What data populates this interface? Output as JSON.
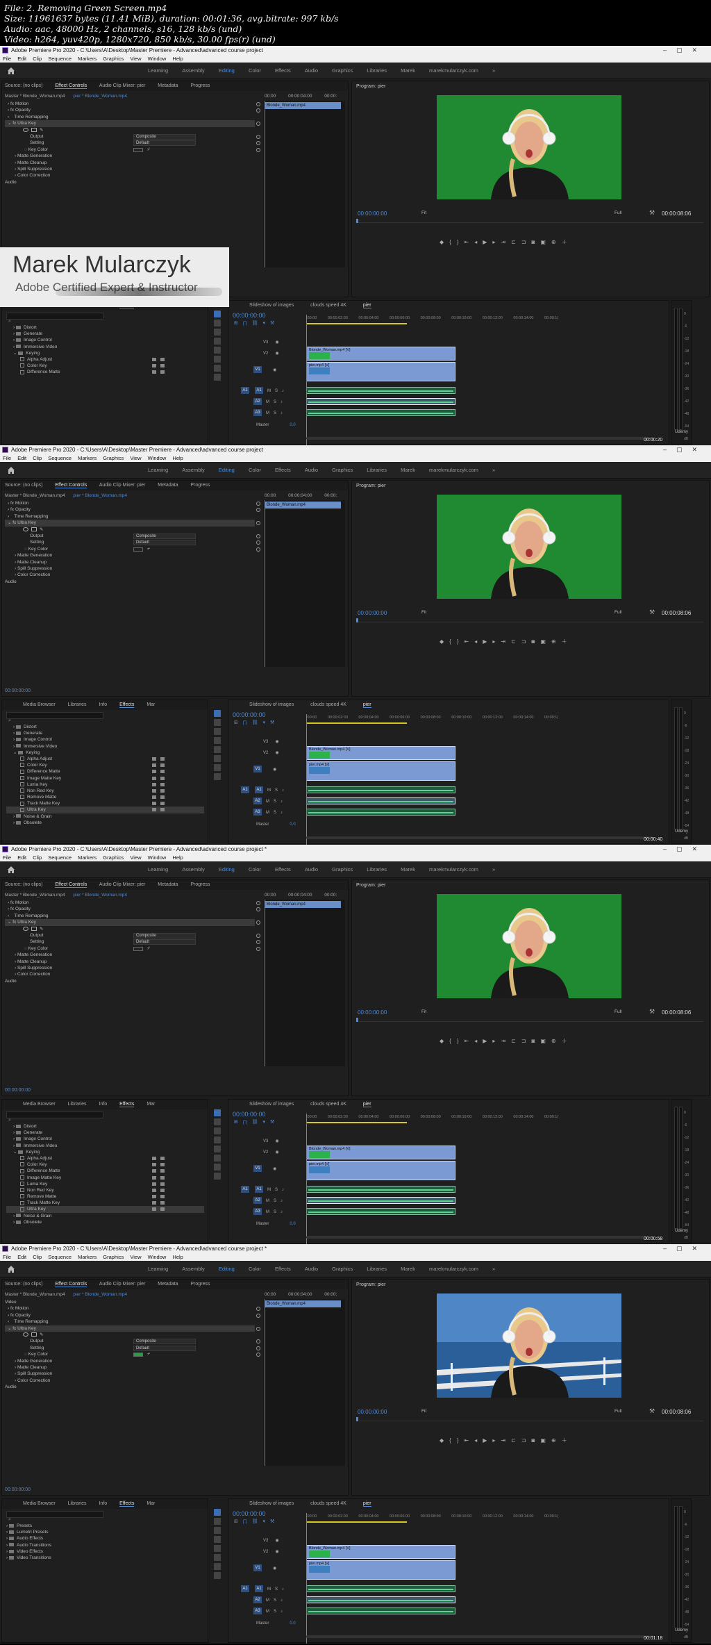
{
  "info": {
    "line1": "File: 2. Removing Green Screen.mp4",
    "line2": "Size: 11961637 bytes (11.41 MiB), duration: 00:01:36, avg.bitrate: 997 kb/s",
    "line3": "Audio: aac, 48000 Hz, 2 channels, s16, 128 kb/s (und)",
    "line4": "Video: h264, yuv420p, 1280x720, 850 kb/s, 30.00 fps(r) (und)"
  },
  "app": {
    "title_saved": "Adobe Premiere Pro 2020 - C:\\Users\\A\\Desktop\\Master Premiere - Advanced\\advanced course project",
    "title_modified": "Adobe Premiere Pro 2020 - C:\\Users\\A\\Desktop\\Master Premiere - Advanced\\advanced course project *",
    "menu": [
      "File",
      "Edit",
      "Clip",
      "Sequence",
      "Markers",
      "Graphics",
      "View",
      "Window",
      "Help"
    ],
    "workspaces": [
      "Learning",
      "Assembly",
      "Editing",
      "Color",
      "Effects",
      "Audio",
      "Graphics",
      "Libraries",
      "Marek",
      "marekmularczyk.com"
    ],
    "active_workspace": "Editing"
  },
  "source_panel": {
    "tabs": [
      "Source: (no clips)",
      "Effect Controls",
      "Audio Clip Mixer: pier",
      "Metadata",
      "Progress"
    ],
    "master_label": "Master * Blonde_Woman.mp4",
    "clip_label": "pier * Blonde_Woman.mp4",
    "times": [
      "00:00",
      "00:00:04:00",
      "00:00:"
    ],
    "clip_name": "Blonde_Woman.mp4",
    "video_label": "Video",
    "rows": {
      "motion": "Motion",
      "opacity": "Opacity",
      "time_remap": "Time Remapping",
      "ultra_key": "Ultra Key",
      "output": "Output",
      "output_value": "Composite",
      "setting": "Setting",
      "setting_value": "Default",
      "key_color": "Key Color",
      "matte_gen": "Matte Generation",
      "matte_clean": "Matte Cleanup",
      "spill": "Spill Suppression",
      "color_corr": "Color Correction",
      "audio": "Audio"
    },
    "timecode": "00:00:00:00"
  },
  "program": {
    "title": "Program: pier",
    "tc_left": "00:00:00:00",
    "tc_right": "00:00:08:06",
    "fit": "Fit",
    "quality": "Full"
  },
  "effects_panel": {
    "tabs": [
      "Media Browser",
      "Libraries",
      "Info",
      "Effects",
      "Mar"
    ],
    "items": {
      "distort": "Distort",
      "generate": "Generate",
      "image_control": "Image Control",
      "immersive": "Immersive Video",
      "keying": "Keying",
      "alpha_adjust": "Alpha Adjust",
      "color_key": "Color Key",
      "difference_matte": "Difference Matte",
      "image_matte_key": "Image Matte Key",
      "luma_key": "Luma Key",
      "non_red_key": "Non Red Key",
      "remove_matte": "Remove Matte",
      "track_matte_key": "Track Matte Key",
      "ultra_key": "Ultra Key",
      "noise_grain": "Noise & Grain",
      "obsolete": "Obsolete",
      "presets": "Presets",
      "lumetri_presets": "Lumetri Presets",
      "audio_effects": "Audio Effects",
      "audio_transitions": "Audio Transitions",
      "video_effects": "Video Effects",
      "video_transitions": "Video Transitions"
    }
  },
  "timeline": {
    "tabs": [
      "Slideshow of images",
      "clouds speed 4K",
      "pier"
    ],
    "timecode": "00:00:00:00",
    "ruler": [
      ":00:00",
      "00:00:02:00",
      "00:00:04:00",
      "00:00:06:00",
      "00:00:08:00",
      "00:00:10:00",
      "00:00:12:00",
      "00:00:14:00",
      "00:00:1("
    ],
    "tracks_v": [
      "V3",
      "V2",
      "V1"
    ],
    "tracks_a": [
      "A1",
      "A2",
      "A3"
    ],
    "mute": "M",
    "solo": "S",
    "clip_v2": "Blonde_Woman.mp4 [V]",
    "clip_v1": "pier.mp4 [V]",
    "master_label": "Master",
    "master_value": "0.0"
  },
  "meter": {
    "ticks": [
      "0",
      "-6",
      "-12",
      "-18",
      "-24",
      "-30",
      "-36",
      "-42",
      "-48",
      "-54",
      "dB"
    ]
  },
  "watermark": {
    "name": "Marek Mularczyk",
    "subtitle": "Adobe Certified Expert & Instructor"
  },
  "frames": [
    {
      "playhead_tc": "00:00:20",
      "udemy": "Udemy"
    },
    {
      "playhead_tc": "00:00:40",
      "udemy": "Udemy"
    },
    {
      "playhead_tc": "00:00:58",
      "udemy": "Udemy"
    },
    {
      "playhead_tc": "00:01:18",
      "udemy": "Udemy"
    }
  ],
  "colors": {
    "accent": "#4e8bd8",
    "green_screen": "#1a7a2c",
    "clip_video": "#7b9ad3",
    "clip_audio": "#1f5c3f",
    "work_area": "#d8c820"
  }
}
